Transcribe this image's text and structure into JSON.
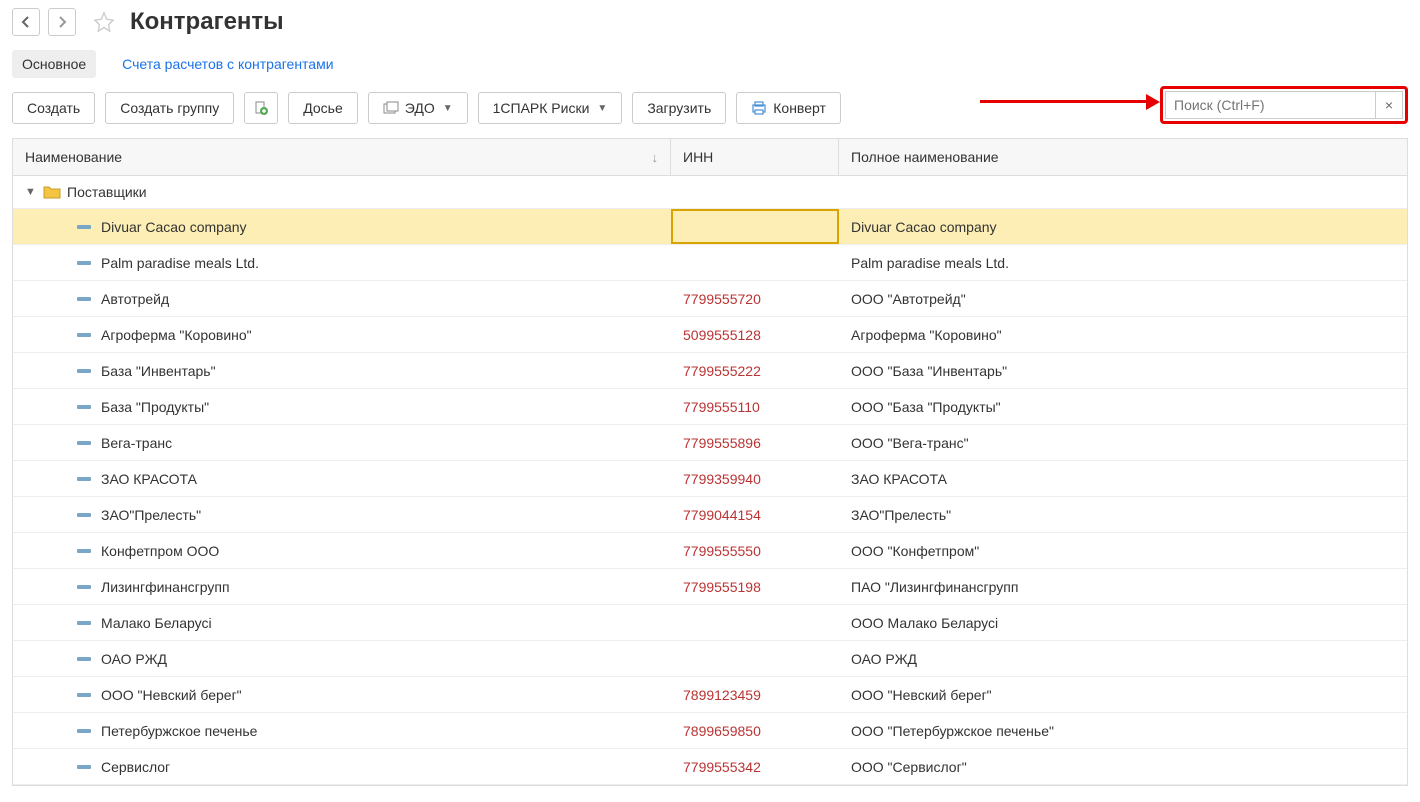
{
  "title": "Контрагенты",
  "tabs": {
    "main": "Основное",
    "accounts": "Счета расчетов с контрагентами"
  },
  "toolbar": {
    "create": "Создать",
    "create_group": "Создать группу",
    "dossier": "Досье",
    "edo": "ЭДО",
    "spark": "1СПАРК Риски",
    "load": "Загрузить",
    "envelope": "Конверт"
  },
  "search": {
    "placeholder": "Поиск (Ctrl+F)"
  },
  "columns": {
    "name": "Наименование",
    "inn": "ИНН",
    "full": "Полное наименование"
  },
  "folder": {
    "name": "Поставщики"
  },
  "rows": [
    {
      "name": "Divuar Cacao company",
      "inn": "",
      "full": "Divuar Cacao company",
      "selected": true
    },
    {
      "name": "Palm paradise meals Ltd.",
      "inn": "",
      "full": "Palm paradise meals Ltd."
    },
    {
      "name": "Автотрейд",
      "inn": "7799555720",
      "full": "ООО \"Автотрейд\""
    },
    {
      "name": "Агроферма \"Коровино\"",
      "inn": "5099555128",
      "full": "Агроферма \"Коровино\""
    },
    {
      "name": "База \"Инвентарь\"",
      "inn": "7799555222",
      "full": "ООО \"База \"Инвентарь\""
    },
    {
      "name": "База \"Продукты\"",
      "inn": "7799555110",
      "full": "ООО \"База \"Продукты\""
    },
    {
      "name": "Вега-транс",
      "inn": "7799555896",
      "full": "ООО \"Вега-транс\""
    },
    {
      "name": "ЗАО КРАСОТА",
      "inn": "7799359940",
      "full": "ЗАО КРАСОТА"
    },
    {
      "name": "ЗАО\"Прелесть\"",
      "inn": "7799044154",
      "full": "ЗАО\"Прелесть\""
    },
    {
      "name": "Конфетпром ООО",
      "inn": "7799555550",
      "full": "ООО \"Конфетпром\""
    },
    {
      "name": "Лизингфинансгрупп",
      "inn": "7799555198",
      "full": "ПАО \"Лизингфинансгрупп"
    },
    {
      "name": "Малако Беларусі",
      "inn": "",
      "full": "ООО Малако Беларусі"
    },
    {
      "name": "ОАО РЖД",
      "inn": "",
      "full": "ОАО РЖД"
    },
    {
      "name": "ООО \"Невский берег\"",
      "inn": "7899123459",
      "full": "ООО \"Невский берег\""
    },
    {
      "name": "Петербуржское печенье",
      "inn": "7899659850",
      "full": "ООО \"Петербуржское печенье\""
    },
    {
      "name": "Сервислог",
      "inn": "7799555342",
      "full": "ООО \"Сервислог\""
    }
  ]
}
